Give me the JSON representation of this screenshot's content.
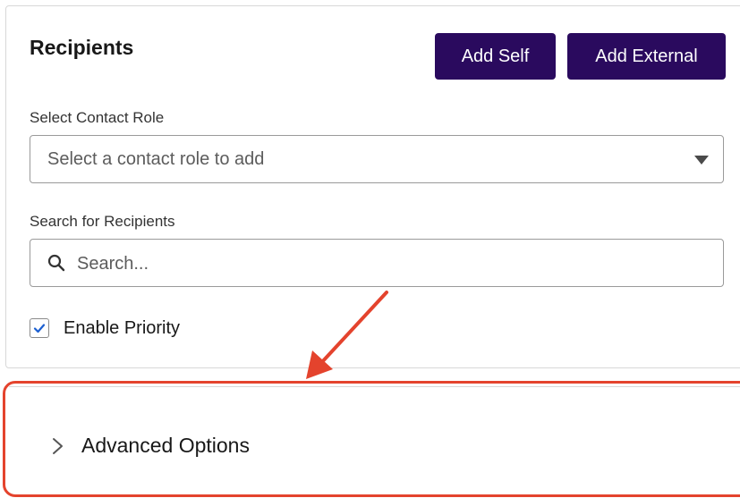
{
  "recipients": {
    "title": "Recipients",
    "add_self_label": "Add Self",
    "add_external_label": "Add External",
    "contact_role": {
      "label": "Select Contact Role",
      "placeholder": "Select a contact role to add"
    },
    "search": {
      "label": "Search for Recipients",
      "placeholder": "Search..."
    },
    "enable_priority": {
      "label": "Enable Priority",
      "checked": true
    }
  },
  "advanced_options": {
    "label": "Advanced Options",
    "expanded": false
  },
  "colors": {
    "button_bg": "#2a0a5e",
    "highlight_border": "#e4432d",
    "checkbox_check": "#1b5fd1"
  },
  "icons": [
    "search-icon",
    "chevron-down-icon",
    "chevron-right-icon",
    "checkmark-icon",
    "annotation-arrow"
  ]
}
